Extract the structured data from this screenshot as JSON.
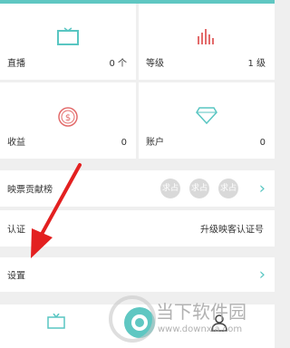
{
  "tiles": [
    {
      "label": "直播",
      "value": "0 个",
      "icon": "tv-icon"
    },
    {
      "label": "等级",
      "value": "1 级",
      "icon": "bar-chart-icon"
    },
    {
      "label": "收益",
      "value": "0",
      "icon": "coin-icon"
    },
    {
      "label": "账户",
      "value": "0",
      "icon": "diamond-icon"
    }
  ],
  "rows": {
    "contribution": {
      "label": "映票贡献榜",
      "badges": [
        "求占",
        "求占",
        "求占"
      ]
    },
    "verify": {
      "label": "认证",
      "value": "升级映客认证号"
    },
    "settings": {
      "label": "设置"
    }
  },
  "tabbar": [
    {
      "icon": "tv-icon"
    },
    {
      "icon": "camera-icon"
    },
    {
      "icon": "profile-icon"
    }
  ],
  "watermark": {
    "title": "当下软件园",
    "url": "www.downxia.com"
  },
  "colors": {
    "accent": "#59c6c2",
    "tv": "#59c6c2",
    "level": "#e36b6b",
    "coin": "#e36b6b",
    "diamond": "#59c6c2",
    "arrow": "#e32020"
  }
}
